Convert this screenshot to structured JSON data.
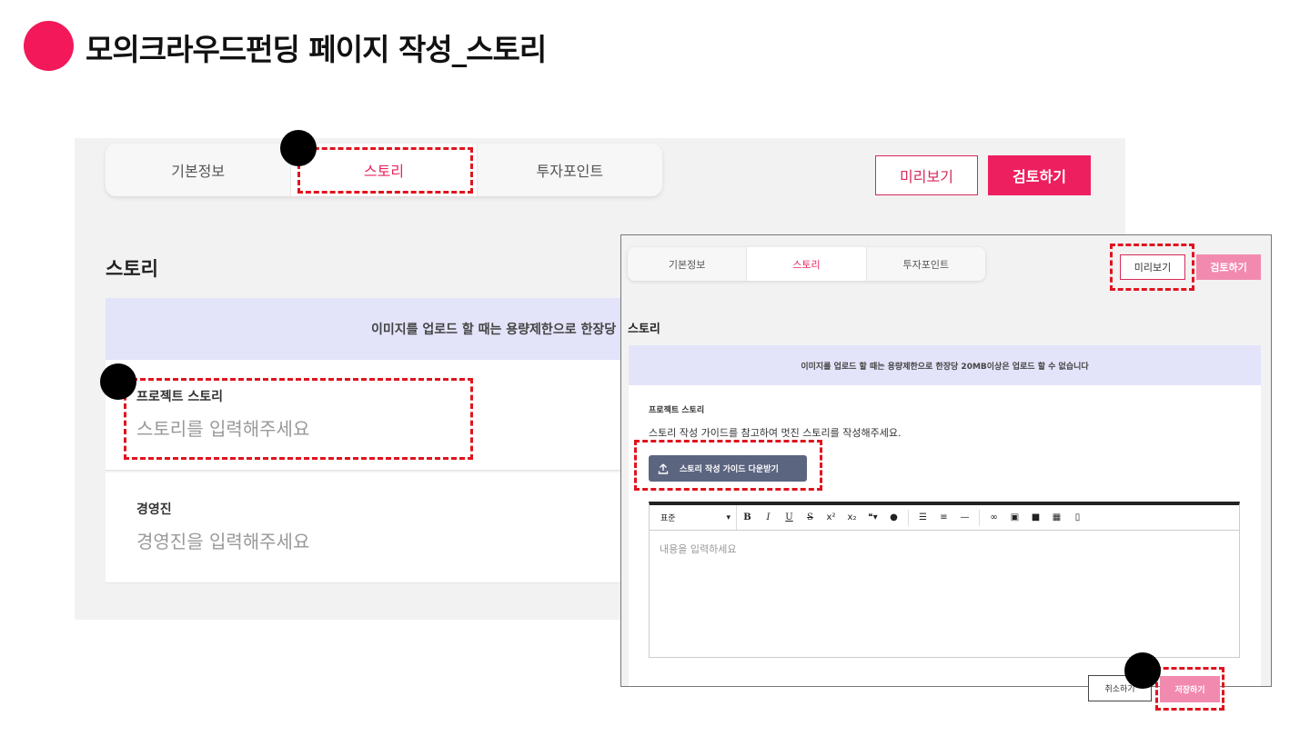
{
  "page": {
    "title": "모의크라우드펀딩 페이지 작성_스토리"
  },
  "colors": {
    "accent": "#f2185a",
    "primary_button": "#ee1f5f",
    "primary_button_disabled": "#f28ab0",
    "notice_bg": "#e3e3fa",
    "download_button": "#5b6580",
    "annotation": "#e0141e"
  },
  "background_screen": {
    "tabs": [
      {
        "label": "기본정보",
        "active": false
      },
      {
        "label": "스토리",
        "active": true
      },
      {
        "label": "투자포인트",
        "active": false
      }
    ],
    "preview_label": "미리보기",
    "review_label": "검토하기",
    "section_title": "스토리",
    "notice": "이미지를 업로드 할 때는 용량제한으로 한장당",
    "fields": [
      {
        "label": "프로젝트 스토리",
        "placeholder": "스토리를 입력해주세요"
      },
      {
        "label": "경영진",
        "placeholder": "경영진을 입력해주세요"
      }
    ]
  },
  "overlay_screen": {
    "tabs": [
      {
        "label": "기본정보",
        "active": false
      },
      {
        "label": "스토리",
        "active": true
      },
      {
        "label": "투자포인트",
        "active": false
      }
    ],
    "preview_label": "미리보기",
    "review_label": "검토하기",
    "section_title": "스토리",
    "notice": "이미지를 업로드 할 때는 용량제한으로 한장당 20MB이상은 업로드 할 수 없습니다",
    "field_label": "프로젝트 스토리",
    "guide_text": "스토리 작성 가이드를 참고하여 멋진 스토리를 작성해주세요.",
    "download_button_label": "스토리 작성 가이드 다운받기",
    "download_icon": "upload-icon",
    "editor": {
      "style_select": "표준",
      "toolbar_icons": [
        "bold-icon",
        "italic-icon",
        "underline-icon",
        "strikethrough-icon",
        "superscript-icon",
        "subscript-icon",
        "quote-icon",
        "color-icon",
        "ordered-list-icon",
        "bullet-list-icon",
        "horizontal-rule-icon",
        "link-icon",
        "image-icon",
        "video-icon",
        "table-icon",
        "file-icon"
      ],
      "placeholder": "내용을 입력하세요"
    },
    "cancel_label": "취소하기",
    "save_label": "저장하기"
  }
}
